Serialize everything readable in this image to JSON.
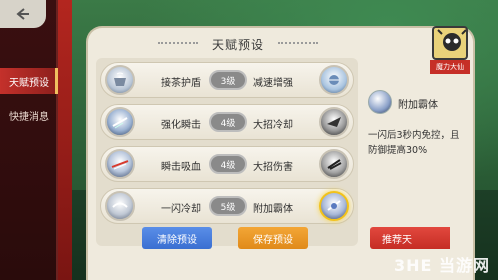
{
  "sidebar": {
    "items": [
      {
        "label": "天赋预设",
        "active": true
      },
      {
        "label": "快捷消息",
        "active": false
      }
    ]
  },
  "panel": {
    "title": "天赋预设",
    "rows": [
      {
        "left": {
          "name": "接茶护盾",
          "icon": "shield-tea-icon"
        },
        "level": "3级",
        "right": {
          "name": "减速增强",
          "icon": "slow-boost-icon"
        }
      },
      {
        "left": {
          "name": "强化瞬击",
          "icon": "strike-icon"
        },
        "level": "4级",
        "right": {
          "name": "大招冷却",
          "icon": "ultimate-cooldown-icon"
        }
      },
      {
        "left": {
          "name": "瞬击吸血",
          "icon": "lifesteal-icon"
        },
        "level": "4级",
        "right": {
          "name": "大招伤害",
          "icon": "ultimate-damage-icon"
        }
      },
      {
        "left": {
          "name": "一闪冷却",
          "icon": "flash-cooldown-icon"
        },
        "level": "5级",
        "right": {
          "name": "附加霸体",
          "icon": "super-armor-icon",
          "selected": true
        }
      }
    ],
    "clear_label": "清除预设",
    "save_label": "保存预设"
  },
  "detail": {
    "name": "附加霸体",
    "description": "一闪后3秒内免控，且防御提高30%"
  },
  "recommend_label": "推荐天",
  "hero": {
    "label": "魔力大仙"
  },
  "watermark": "3HE 当游网",
  "colors": {
    "accent_red": "#c4312b",
    "save_orange": "#f3a636",
    "clear_blue": "#3a6fd1",
    "selected_gold": "#f2c21a"
  }
}
